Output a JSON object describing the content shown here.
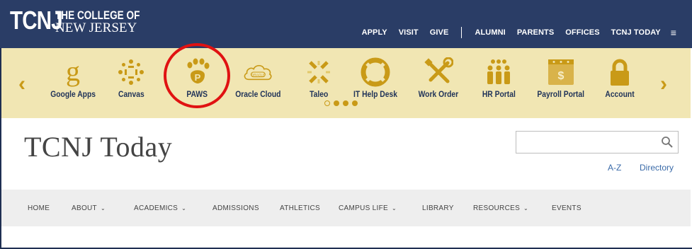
{
  "header": {
    "logo_mark": "TCNJ",
    "logo_line1": "THE COLLEGE OF",
    "logo_line2": "NEW JERSEY",
    "nav_left": [
      "APPLY",
      "VISIT",
      "GIVE"
    ],
    "nav_right": [
      "ALUMNI",
      "PARENTS",
      "OFFICES",
      "TCNJ TODAY"
    ],
    "menu_glyph": "≡"
  },
  "apps": {
    "prev_glyph": "‹",
    "next_glyph": "›",
    "items": [
      {
        "label": "Google Apps",
        "icon": "google-g-icon"
      },
      {
        "label": "Canvas",
        "icon": "canvas-icon"
      },
      {
        "label": "PAWS",
        "icon": "paw-icon"
      },
      {
        "label": "Oracle Cloud",
        "icon": "oracle-cloud-icon"
      },
      {
        "label": "Taleo",
        "icon": "taleo-icon"
      },
      {
        "label": "IT Help Desk",
        "icon": "lifebuoy-icon"
      },
      {
        "label": "Work Order",
        "icon": "tools-icon"
      },
      {
        "label": "HR Portal",
        "icon": "people-icon"
      },
      {
        "label": "Payroll Portal",
        "icon": "payroll-calendar-icon"
      },
      {
        "label": "Account",
        "icon": "lock-icon"
      }
    ],
    "page_count": 4,
    "active_page": 1,
    "accent": "#c99a17",
    "highlight_color": "#e01212"
  },
  "site": {
    "title": "TCNJ Today",
    "search_placeholder": "",
    "az_label": "A-Z",
    "directory_label": "Directory"
  },
  "mainnav": {
    "items": [
      {
        "label": "HOME",
        "dropdown": false
      },
      {
        "label": "ABOUT",
        "dropdown": true
      },
      {
        "label": "ACADEMICS",
        "dropdown": true
      },
      {
        "label": "ADMISSIONS",
        "dropdown": false
      },
      {
        "label": "ATHLETICS",
        "dropdown": false
      },
      {
        "label": "CAMPUS LIFE",
        "dropdown": true
      },
      {
        "label": "LIBRARY",
        "dropdown": false
      },
      {
        "label": "RESOURCES",
        "dropdown": true
      },
      {
        "label": "EVENTS",
        "dropdown": false
      }
    ],
    "caret_glyph": "⌄"
  },
  "colors": {
    "header_bg": "#2a3d66",
    "appbar_bg": "#f1e6b3",
    "label_color": "#1f3258",
    "nav_bg": "#eeeeee"
  }
}
